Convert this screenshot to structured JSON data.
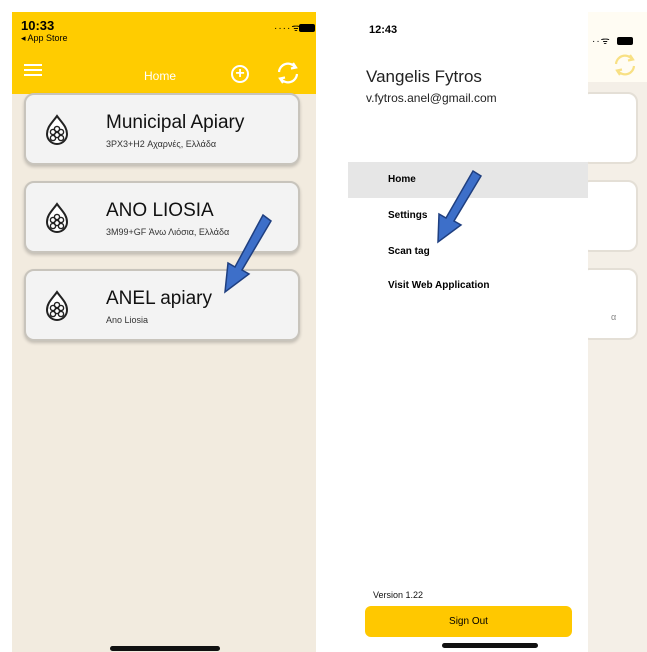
{
  "left": {
    "status": {
      "time": "10:33",
      "back_label": "◂ App Store"
    },
    "nav": {
      "title": "Home"
    },
    "apiaries": [
      {
        "name": "Municipal Apiary",
        "address": "3PX3+H2 Αχαρνές, Ελλάδα"
      },
      {
        "name": "ANO LIOSIA",
        "address": "3M99+GF Άνω Λιόσια, Ελλάδα"
      },
      {
        "name": "ANEL apiary",
        "address": "Ano Liosia"
      }
    ]
  },
  "right": {
    "status": {
      "time": "12:43"
    },
    "user": {
      "name": "Vangelis Fytros",
      "email": "v.fytros.anel@gmail.com"
    },
    "menu": [
      {
        "label": "Home"
      },
      {
        "label": "Settings"
      },
      {
        "label": "Scan tag"
      },
      {
        "label": "Visit Web Application"
      }
    ],
    "version": "Version 1.22",
    "sign_out_label": "Sign Out",
    "background_fragment": "α"
  },
  "colors": {
    "accent": "#ffcc00",
    "background": "#f2ebdf",
    "arrow": "#3d6fc9"
  },
  "icons": [
    "menu-icon",
    "add-icon",
    "refresh-icon",
    "apiary-icon",
    "wifi-icon",
    "battery-icon"
  ]
}
